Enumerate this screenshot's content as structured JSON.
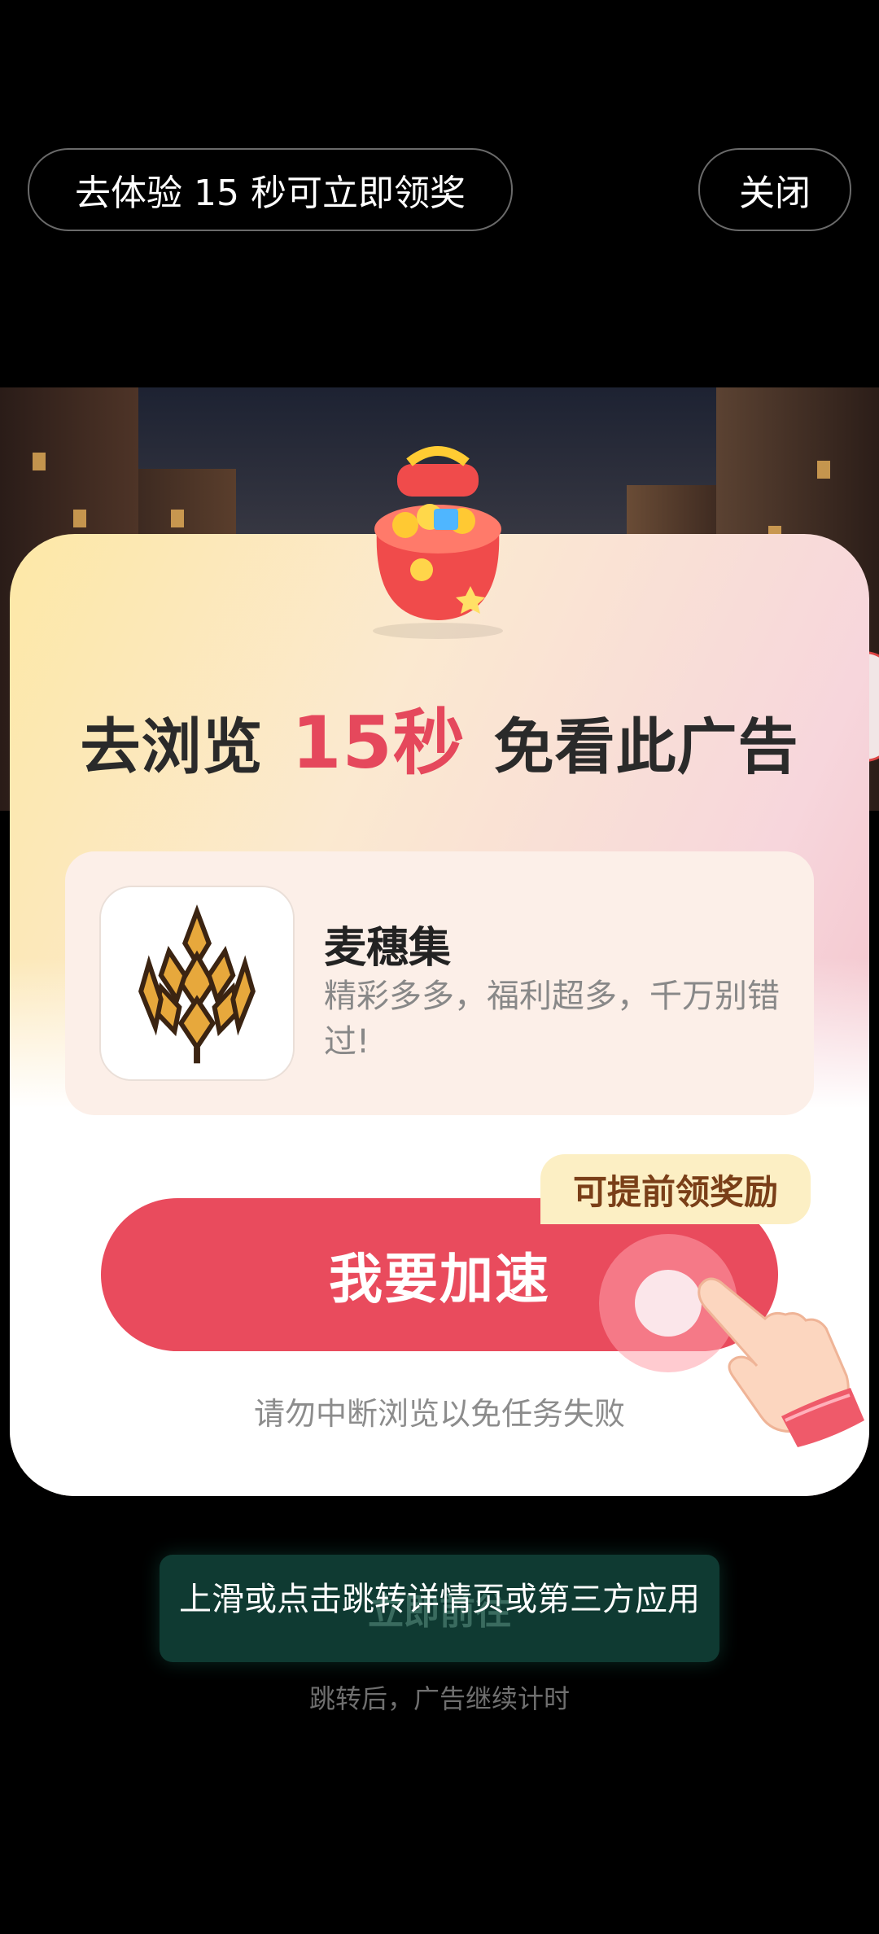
{
  "top": {
    "trial_label": "去体验 15 秒可立即领奖",
    "close_label": "关闭"
  },
  "card": {
    "headline_prefix": "去浏览",
    "headline_highlight": "15秒",
    "headline_suffix": "免看此广告",
    "app": {
      "name": "麦穗集",
      "description": "精彩多多，福利超多，千万别错过!"
    },
    "speed_button": "我要加速",
    "tip_badge": "可提前领奖励",
    "warning": "请勿中断浏览以免任务失败"
  },
  "bottom": {
    "ghost_button": "立即前往",
    "overlay_hint": "上滑或点击跳转详情页或第三方应用",
    "after_note": "跳转后，广告继续计时"
  },
  "colors": {
    "accent_red": "#e94b5d",
    "badge_bg": "#fcefc4",
    "dark_green": "#0f3a32"
  }
}
